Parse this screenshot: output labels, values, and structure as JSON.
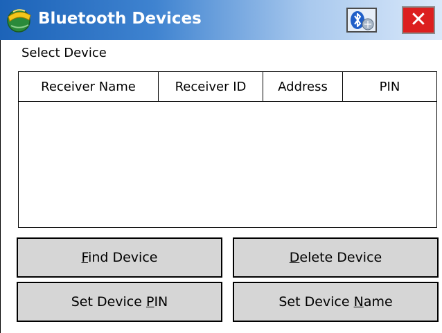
{
  "window": {
    "title": "Bluetooth Devices",
    "close_label": "✕"
  },
  "select_label": "Select Device",
  "columns": [
    "Receiver Name",
    "Receiver ID",
    "Address",
    "PIN"
  ],
  "buttons": {
    "find_pre": "",
    "find_key": "F",
    "find_post": "ind Device",
    "delete_pre": "",
    "delete_key": "D",
    "delete_post": "elete Device",
    "setpin_pre": "Set Device ",
    "setpin_key": "P",
    "setpin_post": "IN",
    "setname_pre": "Set Device ",
    "setname_key": "N",
    "setname_post": "ame"
  },
  "colors": {
    "title_gradient_start": "#1c63b8",
    "close_red": "#dc1f1f",
    "button_face": "#d6d6d6"
  }
}
